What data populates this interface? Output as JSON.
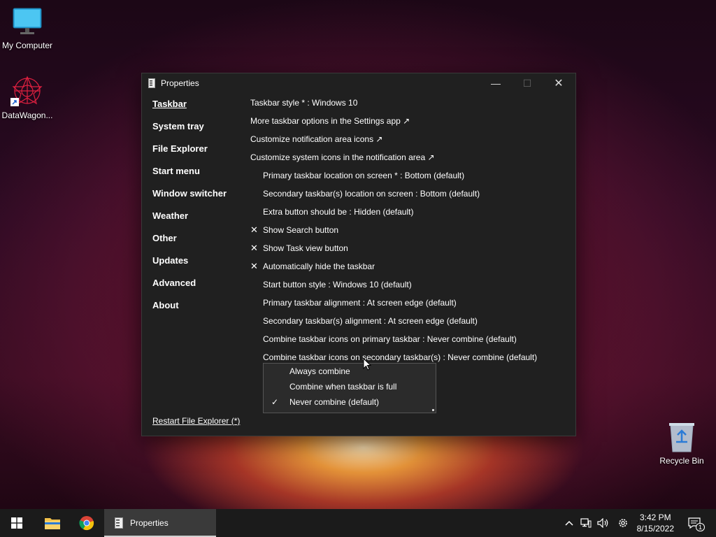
{
  "desktop": {
    "icons": [
      {
        "label": "My Computer"
      },
      {
        "label": "DataWagon..."
      },
      {
        "label": "Recycle Bin"
      }
    ]
  },
  "window": {
    "title": "Properties",
    "minimize": "—",
    "maximize": "☐",
    "close": "✕"
  },
  "sidebar": {
    "items": [
      {
        "label": "Taskbar"
      },
      {
        "label": "System tray"
      },
      {
        "label": "File Explorer"
      },
      {
        "label": "Start menu"
      },
      {
        "label": "Window switcher"
      },
      {
        "label": "Weather"
      },
      {
        "label": "Other"
      },
      {
        "label": "Updates"
      },
      {
        "label": "Advanced"
      },
      {
        "label": "About"
      }
    ],
    "restart_label": "Restart File Explorer (*)"
  },
  "settings": [
    {
      "text": "Taskbar style * : Windows 10",
      "check": ""
    },
    {
      "text": "More taskbar options in the Settings app ↗",
      "check": ""
    },
    {
      "text": "Customize notification area icons ↗",
      "check": ""
    },
    {
      "text": "Customize system icons in the notification area ↗",
      "check": ""
    },
    {
      "text": "Primary taskbar location on screen * : Bottom (default)",
      "check": ""
    },
    {
      "text": "Secondary taskbar(s) location on screen : Bottom (default)",
      "check": ""
    },
    {
      "text": "Extra button should be : Hidden (default)",
      "check": ""
    },
    {
      "text": "Show Search button",
      "check": "✕"
    },
    {
      "text": "Show Task view button",
      "check": "✕"
    },
    {
      "text": "Automatically hide the taskbar",
      "check": "✕"
    },
    {
      "text": "Start button style : Windows 10 (default)",
      "check": ""
    },
    {
      "text": "Primary taskbar alignment : At screen edge (default)",
      "check": ""
    },
    {
      "text": "Secondary taskbar(s) alignment : At screen edge (default)",
      "check": ""
    },
    {
      "text": "Combine taskbar icons on primary taskbar : Never combine (default)",
      "check": ""
    },
    {
      "text": "Combine taskbar icons on secondary taskbar(s) : Never combine (default)",
      "check": ""
    }
  ],
  "dropdown": {
    "options": [
      {
        "label": "Always combine",
        "tick": ""
      },
      {
        "label": "Combine when taskbar is full",
        "tick": ""
      },
      {
        "label": "Never combine (default)",
        "tick": "✓"
      }
    ]
  },
  "taskbar": {
    "active_app": "Properties",
    "time": "3:42 PM",
    "date": "8/15/2022",
    "notification_count": "1"
  },
  "colors": {
    "window_bg": "#202020",
    "taskbar_bg": "#1b1b1b",
    "accent": "#ffffff"
  }
}
